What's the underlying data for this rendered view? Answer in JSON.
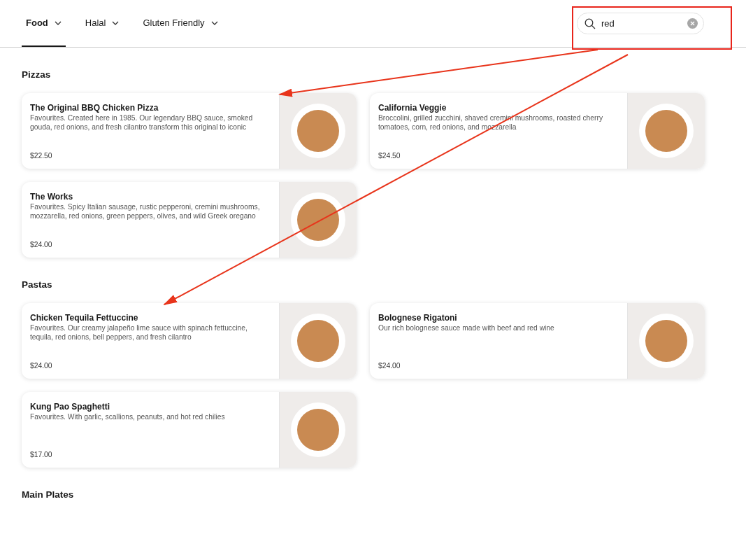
{
  "tabs": [
    {
      "label": "Food",
      "selected": true
    },
    {
      "label": "Halal",
      "selected": false
    },
    {
      "label": "Gluten Friendly",
      "selected": false
    }
  ],
  "search": {
    "value": "red"
  },
  "sections": [
    {
      "title": "Pizzas",
      "items": [
        {
          "name": "The Original BBQ Chicken Pizza",
          "description": "Favourites. Created here in 1985. Our legendary BBQ sauce, smoked gouda, red onions, and fresh cilantro transform this original to iconic",
          "price": "$22.50"
        },
        {
          "name": "California Veggie",
          "description": "Broccolini, grilled zucchini, shaved cremini mushrooms, roasted cherry tomatoes, corn, red onions, and mozzarella",
          "price": "$24.50"
        },
        {
          "name": "The Works",
          "description": "Favourites. Spicy Italian sausage, rustic pepperoni, cremini mushrooms, mozzarella, red onions, green peppers, olives, and wild Greek oregano",
          "price": "$24.00"
        }
      ]
    },
    {
      "title": "Pastas",
      "items": [
        {
          "name": "Chicken Tequila Fettuccine",
          "description": "Favourites. Our creamy jalapeño lime sauce with spinach fettuccine, tequila, red onions, bell peppers, and fresh cilantro",
          "price": "$24.00"
        },
        {
          "name": "Bolognese Rigatoni",
          "description": "Our rich bolognese sauce made with beef and red wine",
          "price": "$24.00"
        },
        {
          "name": "Kung Pao Spaghetti",
          "description": "Favourites. With garlic, scallions, peanuts, and hot red chilies",
          "price": "$17.00"
        }
      ]
    },
    {
      "title": "Main Plates"
    }
  ]
}
